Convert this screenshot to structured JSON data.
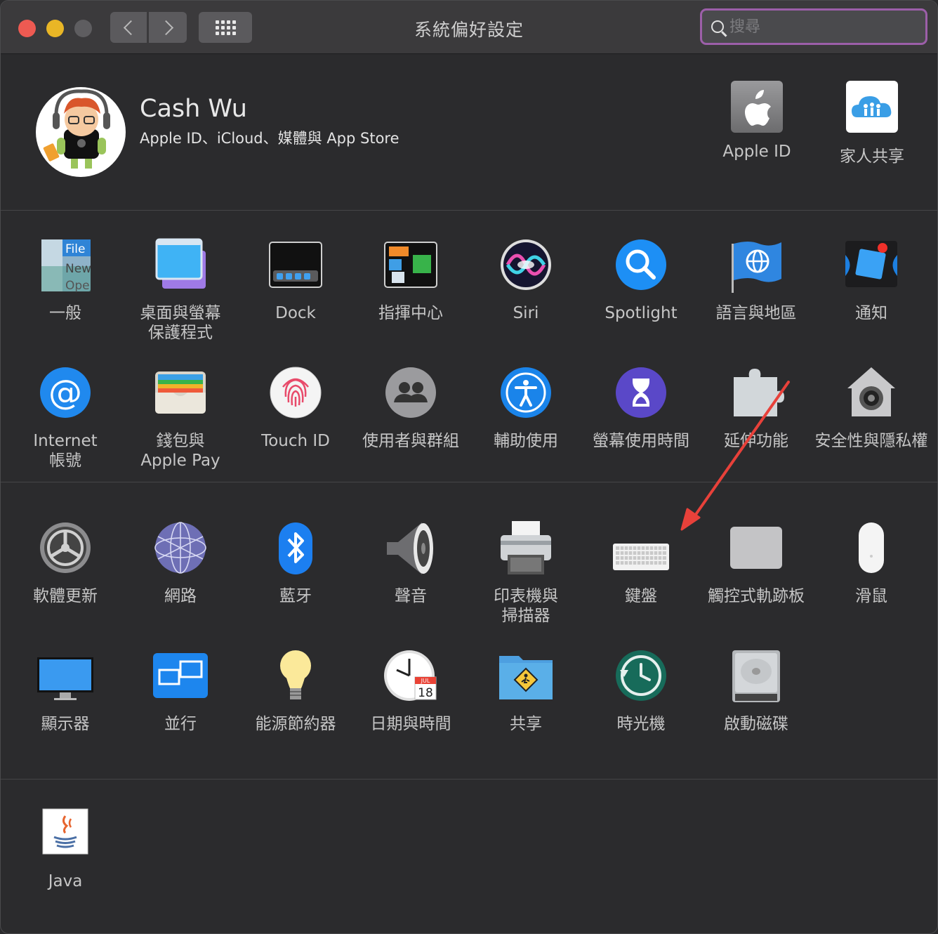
{
  "window": {
    "title": "系統偏好設定",
    "search_placeholder": "搜尋"
  },
  "account": {
    "name": "Cash Wu",
    "subtitle": "Apple ID、iCloud、媒體與 App Store",
    "items": [
      {
        "label": "Apple ID",
        "icon": "apple-id-icon"
      },
      {
        "label": "家人共享",
        "icon": "family-sharing-icon"
      }
    ]
  },
  "section1": [
    {
      "label": "一般",
      "icon": "general-icon"
    },
    {
      "label": "桌面與螢幕\n保護程式",
      "icon": "desktop-screensaver-icon"
    },
    {
      "label": "Dock",
      "icon": "dock-icon"
    },
    {
      "label": "指揮中心",
      "icon": "mission-control-icon"
    },
    {
      "label": "Siri",
      "icon": "siri-icon"
    },
    {
      "label": "Spotlight",
      "icon": "spotlight-icon"
    },
    {
      "label": "語言與地區",
      "icon": "language-region-icon"
    },
    {
      "label": "通知",
      "icon": "notifications-icon"
    },
    {
      "label": "Internet\n帳號",
      "icon": "internet-accounts-icon"
    },
    {
      "label": "錢包與\nApple Pay",
      "icon": "wallet-applepay-icon"
    },
    {
      "label": "Touch ID",
      "icon": "touch-id-icon"
    },
    {
      "label": "使用者與群組",
      "icon": "users-groups-icon"
    },
    {
      "label": "輔助使用",
      "icon": "accessibility-icon"
    },
    {
      "label": "螢幕使用時間",
      "icon": "screen-time-icon"
    },
    {
      "label": "延伸功能",
      "icon": "extensions-icon"
    },
    {
      "label": "安全性與隱私權",
      "icon": "security-privacy-icon"
    }
  ],
  "section2": [
    {
      "label": "軟體更新",
      "icon": "software-update-icon"
    },
    {
      "label": "網路",
      "icon": "network-icon"
    },
    {
      "label": "藍牙",
      "icon": "bluetooth-icon"
    },
    {
      "label": "聲音",
      "icon": "sound-icon"
    },
    {
      "label": "印表機與\n掃描器",
      "icon": "printers-scanners-icon"
    },
    {
      "label": "鍵盤",
      "icon": "keyboard-icon"
    },
    {
      "label": "觸控式軌跡板",
      "icon": "trackpad-icon"
    },
    {
      "label": "滑鼠",
      "icon": "mouse-icon"
    },
    {
      "label": "顯示器",
      "icon": "displays-icon"
    },
    {
      "label": "並行",
      "icon": "sidecar-icon"
    },
    {
      "label": "能源節約器",
      "icon": "energy-saver-icon"
    },
    {
      "label": "日期與時間",
      "icon": "date-time-icon"
    },
    {
      "label": "共享",
      "icon": "sharing-icon"
    },
    {
      "label": "時光機",
      "icon": "time-machine-icon"
    },
    {
      "label": "啟動磁碟",
      "icon": "startup-disk-icon"
    }
  ],
  "section3": [
    {
      "label": "Java",
      "icon": "java-icon"
    }
  ],
  "calendar_icon": {
    "month": "JUL",
    "day": "18"
  },
  "general_icon_text": {
    "line1": "File",
    "line2": "New",
    "line3": "Ope"
  },
  "annotation": {
    "color": "#e8413a",
    "target": "鍵盤"
  }
}
